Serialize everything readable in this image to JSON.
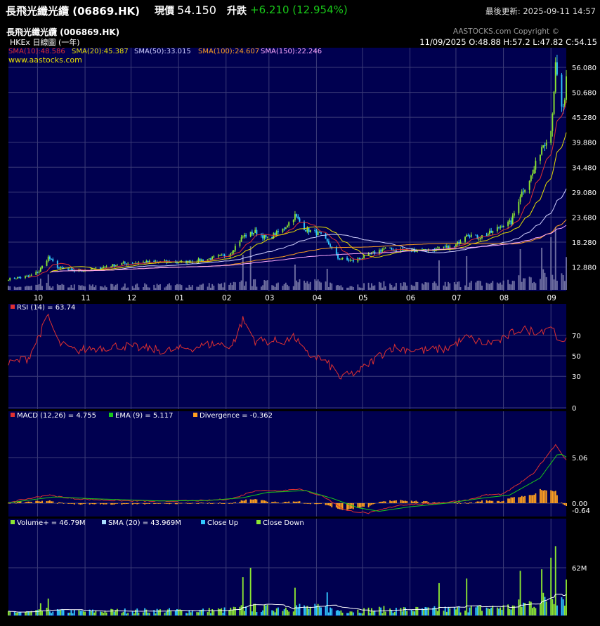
{
  "header": {
    "name": "長飛光纖光纜 (06869.HK)",
    "price_label": "現價",
    "price": "54.150",
    "change_label": "升跌",
    "change": "+6.210 (12.954%)",
    "last_update": "最後更新: 2025-09-11 14:57"
  },
  "chart": {
    "title": "長飛光纖光纜 (006869.HK)",
    "copyright": "AASTOCKS.com Copyright ©",
    "market": "HKEx  日線圖 (一年)",
    "website": "www.aastocks.com",
    "ohlc": "11/09/2025   O:48.88  H:57.2  L:47.82  C:54.15",
    "colors": {
      "background": "#000050",
      "grid": "#3c3c78",
      "sma10": "#e03030",
      "sma20": "#e8e000",
      "sma50": "#d0d0ff",
      "sma100": "#ffa020",
      "sma150": "#ffaaff",
      "candle_up": "#8ce632",
      "candle_down": "#32c8ff",
      "volume_bg": "#6e6ea0"
    }
  },
  "chart_data": [
    {
      "type": "candlestick",
      "panel": "price",
      "legend": [
        "SMA(10):48.586",
        "SMA(20):45.387",
        "SMA(50):33.015",
        "SMA(100):24.607",
        "SMA(150):22.246"
      ],
      "y_ticks": [
        "56.080",
        "50.680",
        "45.280",
        "39.880",
        "34.480",
        "29.080",
        "23.680",
        "18.280",
        "12.880"
      ],
      "y_values": [
        56.08,
        50.68,
        45.28,
        39.88,
        34.48,
        29.08,
        23.68,
        18.28,
        12.88
      ],
      "x_ticks": [
        "10",
        "11",
        "12",
        "01",
        "02",
        "03",
        "04",
        "05",
        "06",
        "07",
        "08",
        "09"
      ],
      "price_path": [
        [
          "2024-09-12",
          10.3
        ],
        [
          "2024-09-26",
          10.9
        ],
        [
          "2024-10-02",
          12.0
        ],
        [
          "2024-10-08",
          15.0
        ],
        [
          "2024-10-15",
          12.6
        ],
        [
          "2024-10-25",
          12.1
        ],
        [
          "2024-11-05",
          12.3
        ],
        [
          "2024-11-15",
          13.0
        ],
        [
          "2024-11-25",
          13.6
        ],
        [
          "2024-12-10",
          13.9
        ],
        [
          "2024-12-20",
          14.0
        ],
        [
          "2025-01-05",
          13.9
        ],
        [
          "2025-01-20",
          14.6
        ],
        [
          "2025-02-03",
          15.6
        ],
        [
          "2025-02-12",
          19.5
        ],
        [
          "2025-02-20",
          20.5
        ],
        [
          "2025-02-28",
          19.0
        ],
        [
          "2025-03-10",
          21.0
        ],
        [
          "2025-03-18",
          24.0
        ],
        [
          "2025-03-25",
          21.0
        ],
        [
          "2025-04-03",
          20.0
        ],
        [
          "2025-04-10",
          17.5
        ],
        [
          "2025-04-15",
          14.8
        ],
        [
          "2025-04-25",
          14.2
        ],
        [
          "2025-05-05",
          15.5
        ],
        [
          "2025-05-15",
          16.8
        ],
        [
          "2025-05-30",
          16.5
        ],
        [
          "2025-06-15",
          16.6
        ],
        [
          "2025-06-30",
          17.2
        ],
        [
          "2025-07-08",
          20.2
        ],
        [
          "2025-07-15",
          19.2
        ],
        [
          "2025-07-25",
          20.5
        ],
        [
          "2025-07-31",
          22.0
        ],
        [
          "2025-08-06",
          22.5
        ],
        [
          "2025-08-12",
          28.5
        ],
        [
          "2025-08-20",
          33.0
        ],
        [
          "2025-08-26",
          39.0
        ],
        [
          "2025-09-01",
          42.5
        ],
        [
          "2025-09-04",
          56.0
        ],
        [
          "2025-09-08",
          47.0
        ],
        [
          "2025-09-10",
          48.2
        ],
        [
          "2025-09-11",
          54.15
        ]
      ],
      "sma_end": {
        "sma10": 48.586,
        "sma20": 45.387,
        "sma50": 33.015,
        "sma100": 24.607,
        "sma150": 22.246
      }
    },
    {
      "type": "line",
      "panel": "rsi",
      "legend": [
        "RSI (14)  = 63.74"
      ],
      "y_ticks": [
        "70",
        "50",
        "30",
        "0"
      ],
      "y_values": [
        70,
        50,
        30,
        0
      ],
      "values": [
        [
          "2024-09-12",
          42
        ],
        [
          "2024-09-25",
          48
        ],
        [
          "2024-10-02",
          70
        ],
        [
          "2024-10-08",
          88
        ],
        [
          "2024-10-15",
          62
        ],
        [
          "2024-10-25",
          55
        ],
        [
          "2024-11-10",
          58
        ],
        [
          "2024-11-25",
          60
        ],
        [
          "2024-12-10",
          57
        ],
        [
          "2024-12-25",
          55
        ],
        [
          "2025-01-10",
          58
        ],
        [
          "2025-01-25",
          62
        ],
        [
          "2025-02-05",
          60
        ],
        [
          "2025-02-12",
          85
        ],
        [
          "2025-02-20",
          65
        ],
        [
          "2025-03-10",
          64
        ],
        [
          "2025-03-18",
          68
        ],
        [
          "2025-03-25",
          52
        ],
        [
          "2025-04-03",
          48
        ],
        [
          "2025-04-10",
          40
        ],
        [
          "2025-04-17",
          28
        ],
        [
          "2025-04-30",
          36
        ],
        [
          "2025-05-10",
          48
        ],
        [
          "2025-05-20",
          58
        ],
        [
          "2025-06-10",
          55
        ],
        [
          "2025-06-25",
          57
        ],
        [
          "2025-07-08",
          68
        ],
        [
          "2025-07-20",
          62
        ],
        [
          "2025-07-31",
          65
        ],
        [
          "2025-08-10",
          76
        ],
        [
          "2025-08-25",
          74
        ],
        [
          "2025-09-01",
          80
        ],
        [
          "2025-09-05",
          70
        ],
        [
          "2025-09-08",
          60
        ],
        [
          "2025-09-11",
          63.74
        ]
      ]
    },
    {
      "type": "line",
      "panel": "macd",
      "legend": [
        "MACD (12,26) = 4.755",
        "EMA (9) = 5.117",
        "Divergence = -0.362"
      ],
      "y_ticks": [
        "5.06",
        "0.00",
        "-0.64"
      ],
      "y_values": [
        5.06,
        0.0,
        -0.64
      ],
      "macd": [
        [
          "2024-09-12",
          0.1
        ],
        [
          "2024-10-08",
          0.9
        ],
        [
          "2024-10-25",
          0.5
        ],
        [
          "2024-11-20",
          0.3
        ],
        [
          "2024-12-20",
          0.2
        ],
        [
          "2025-01-20",
          0.3
        ],
        [
          "2025-02-05",
          0.5
        ],
        [
          "2025-02-20",
          1.4
        ],
        [
          "2025-03-10",
          1.4
        ],
        [
          "2025-03-20",
          1.6
        ],
        [
          "2025-04-05",
          0.8
        ],
        [
          "2025-04-20",
          -0.8
        ],
        [
          "2025-05-05",
          -1.1
        ],
        [
          "2025-05-25",
          -0.2
        ],
        [
          "2025-06-20",
          0.0
        ],
        [
          "2025-07-10",
          0.4
        ],
        [
          "2025-07-20",
          0.9
        ],
        [
          "2025-08-01",
          1.0
        ],
        [
          "2025-08-20",
          3.2
        ],
        [
          "2025-09-04",
          6.5
        ],
        [
          "2025-09-11",
          4.755
        ]
      ],
      "ema9": [
        [
          "2024-09-12",
          0.05
        ],
        [
          "2024-10-12",
          0.7
        ],
        [
          "2024-11-05",
          0.5
        ],
        [
          "2024-12-20",
          0.25
        ],
        [
          "2025-01-20",
          0.3
        ],
        [
          "2025-02-12",
          0.6
        ],
        [
          "2025-02-28",
          1.2
        ],
        [
          "2025-03-25",
          1.4
        ],
        [
          "2025-04-12",
          0.5
        ],
        [
          "2025-04-28",
          -0.5
        ],
        [
          "2025-05-12",
          -0.9
        ],
        [
          "2025-06-01",
          -0.4
        ],
        [
          "2025-06-25",
          0.0
        ],
        [
          "2025-07-20",
          0.6
        ],
        [
          "2025-08-05",
          0.9
        ],
        [
          "2025-08-25",
          2.8
        ],
        [
          "2025-09-06",
          5.6
        ],
        [
          "2025-09-11",
          5.117
        ]
      ]
    },
    {
      "type": "bar",
      "panel": "volume",
      "legend": [
        "Volume+  = 46.79M",
        "SMA (20)  = 43.969M",
        "Close Up",
        "Close Down"
      ],
      "y_ticks": [
        "62M"
      ],
      "y_values": [
        62
      ],
      "spikes": [
        [
          "2024-10-03",
          16
        ],
        [
          "2024-10-08",
          22
        ],
        [
          "2025-02-12",
          50
        ],
        [
          "2025-02-17",
          62
        ],
        [
          "2025-03-18",
          36
        ],
        [
          "2025-04-08",
          30
        ],
        [
          "2025-06-20",
          42
        ],
        [
          "2025-07-08",
          48
        ],
        [
          "2025-08-12",
          58
        ],
        [
          "2025-08-26",
          60
        ],
        [
          "2025-09-01",
          75
        ],
        [
          "2025-09-04",
          90
        ],
        [
          "2025-09-11",
          46.79
        ]
      ],
      "sma20_end": 43.969
    }
  ]
}
